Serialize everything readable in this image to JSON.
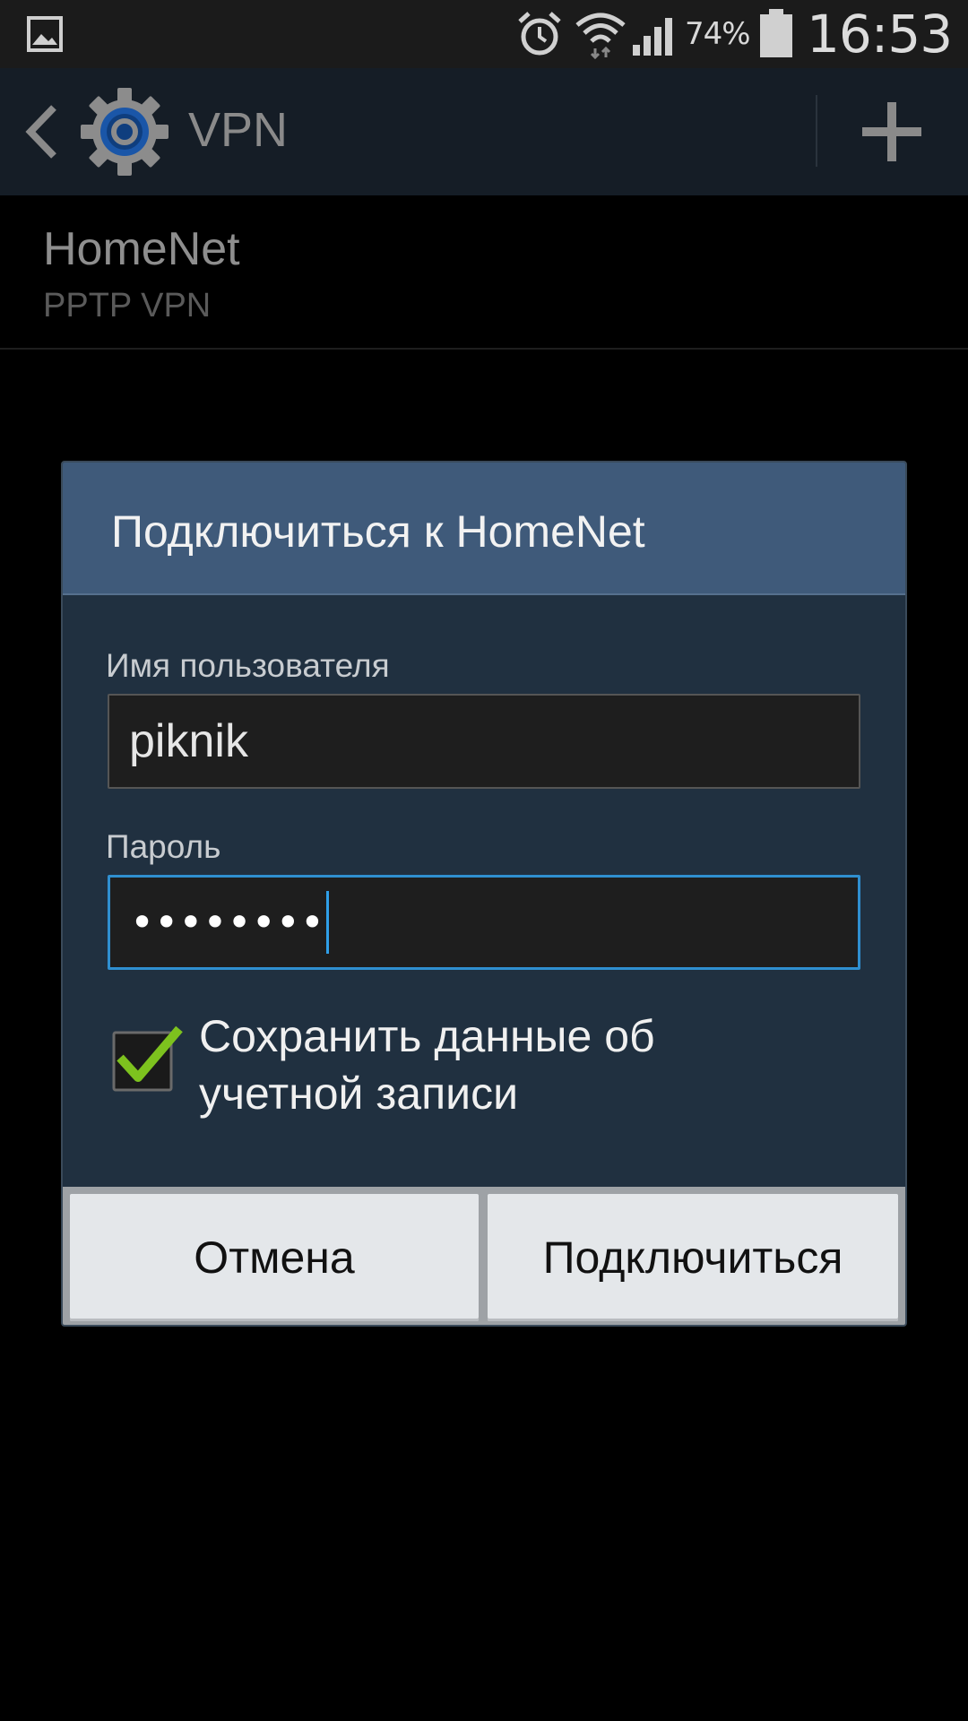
{
  "status_bar": {
    "battery_percent": "74%",
    "time": "16:53",
    "icons": [
      "gallery-icon",
      "alarm-icon",
      "wifi-icon",
      "signal-icon",
      "battery-icon"
    ]
  },
  "action_bar": {
    "title": "VPN",
    "icons": [
      "back-icon",
      "settings-gear-icon",
      "add-icon"
    ]
  },
  "vpn_list": {
    "items": [
      {
        "name": "HomeNet",
        "type": "PPTP VPN"
      }
    ]
  },
  "dialog": {
    "title": "Подключиться к HomeNet",
    "username_label": "Имя пользователя",
    "username_value": "piknik",
    "password_label": "Пароль",
    "password_mask": "••••••••",
    "save_credentials_label": "Сохранить данные об учетной записи",
    "save_credentials_checked": true,
    "cancel_label": "Отмена",
    "connect_label": "Подключиться"
  },
  "colors": {
    "dialog_header": "#3f5a7a",
    "dialog_body": "#203040",
    "focus_accent": "#2f8fd0",
    "check_green": "#7dc21e"
  }
}
